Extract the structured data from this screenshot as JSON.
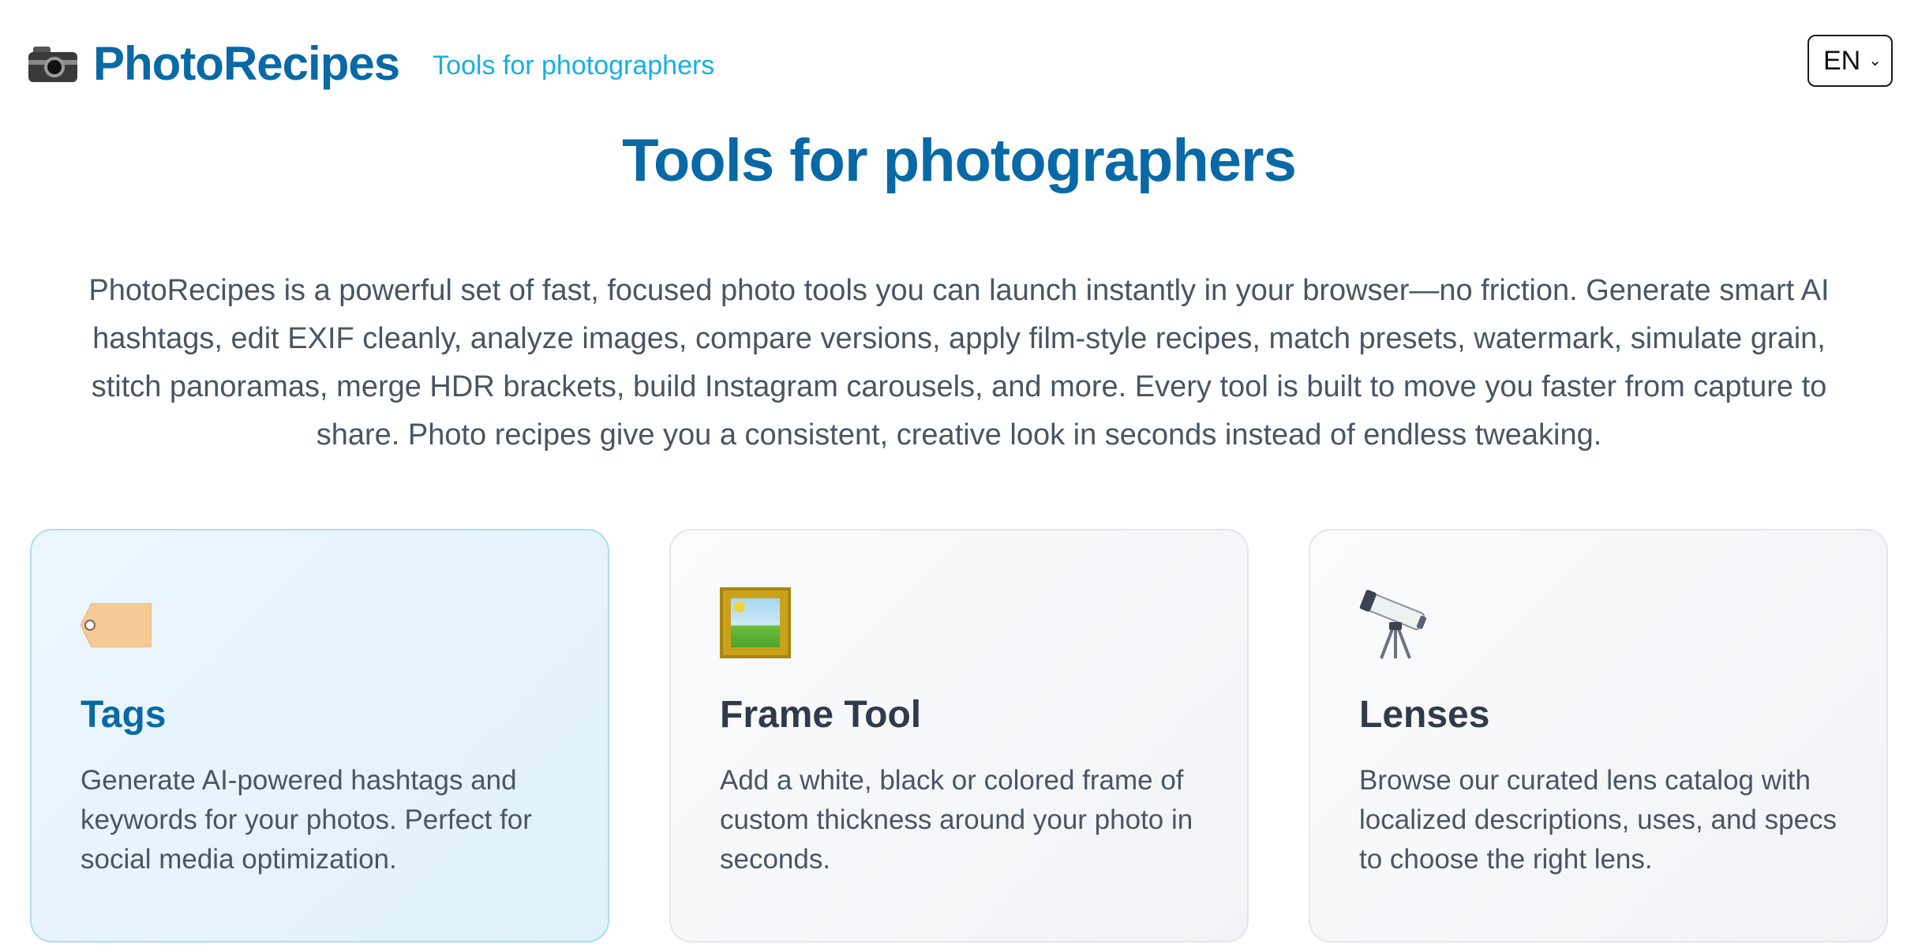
{
  "header": {
    "brand_icon": "camera-icon",
    "brand_name": "PhotoRecipes",
    "tagline": "Tools for photographers",
    "language": "EN"
  },
  "hero": {
    "title": "Tools for photographers",
    "intro": "PhotoRecipes is a powerful set of fast, focused photo tools you can launch instantly in your browser—no friction. Generate smart AI hashtags, edit EXIF cleanly, analyze images, compare versions, apply film-style recipes, match presets, watermark, simulate grain, stitch panoramas, merge HDR brackets, build Instagram carousels, and more. Every tool is built to move you faster from capture to share. Photo recipes give you a consistent, creative look in seconds instead of endless tweaking."
  },
  "cards": [
    {
      "icon": "tag-icon",
      "title": "Tags",
      "description": "Generate AI-powered hashtags and keywords for your photos. Perfect for social media optimization.",
      "highlighted": true
    },
    {
      "icon": "framed-picture-icon",
      "title": "Frame Tool",
      "description": "Add a white, black or colored frame of custom thickness around your photo in seconds.",
      "highlighted": false
    },
    {
      "icon": "telescope-icon",
      "title": "Lenses",
      "description": "Browse our curated lens catalog with localized descriptions, uses, and specs to choose the right lens.",
      "highlighted": false
    }
  ],
  "colors": {
    "brand": "#0869a6",
    "accent": "#16b0e4",
    "body_text": "#4a5563",
    "card_highlight_border": "#a9def3"
  }
}
